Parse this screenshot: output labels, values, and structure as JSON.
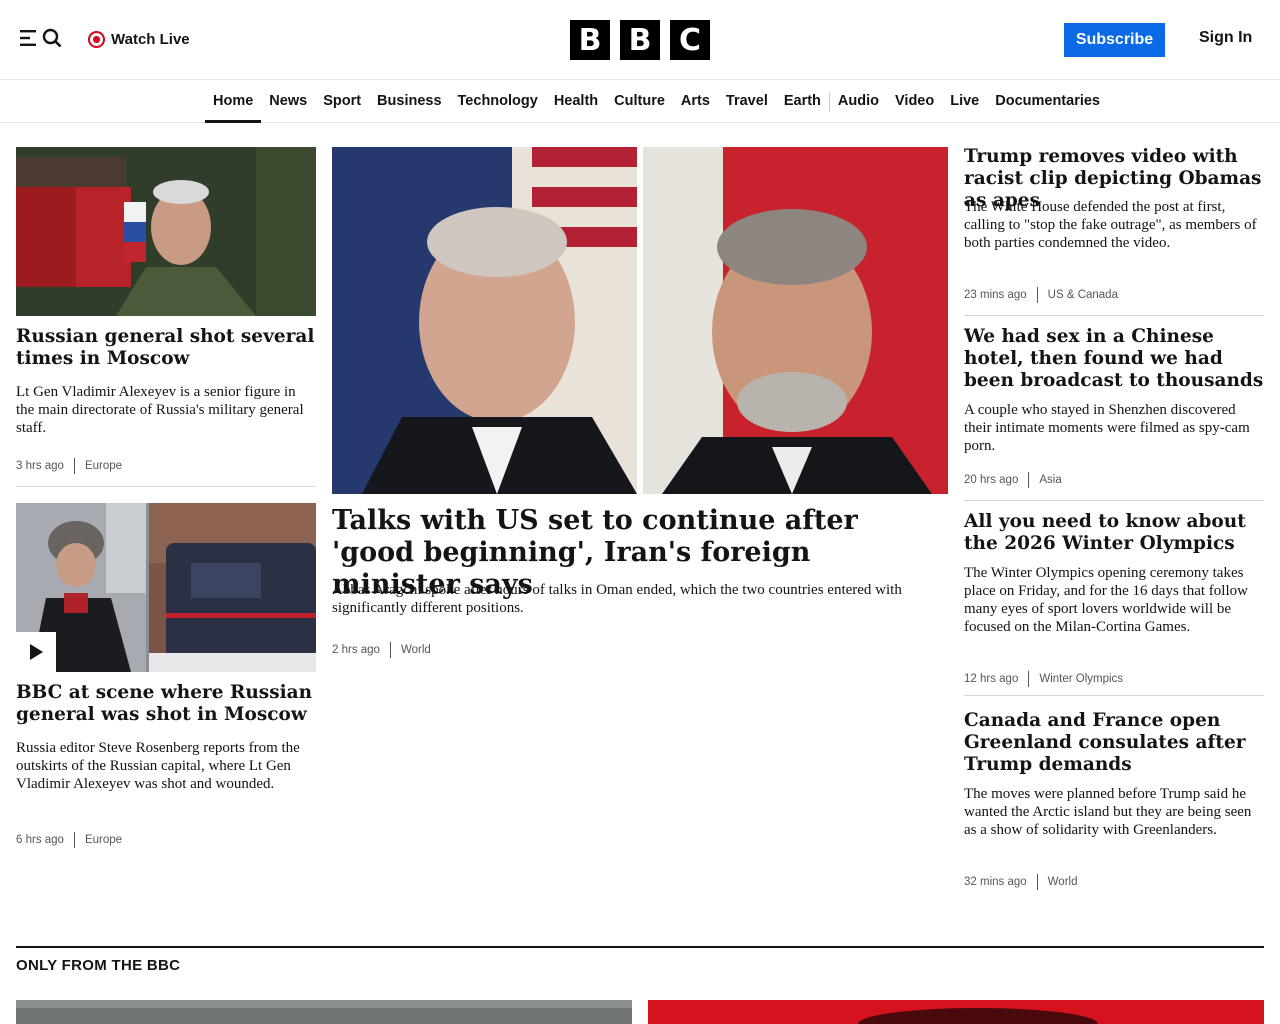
{
  "header": {
    "watch_live": "Watch Live",
    "logo_letters": [
      "B",
      "B",
      "C"
    ],
    "subscribe": "Subscribe",
    "sign_in": "Sign In"
  },
  "nav": {
    "items": [
      "Home",
      "News",
      "Sport",
      "Business",
      "Technology",
      "Health",
      "Culture",
      "Arts",
      "Travel",
      "Earth",
      "Audio",
      "Video",
      "Live",
      "Documentaries"
    ],
    "active": "Home"
  },
  "left": [
    {
      "headline": "Russian general shot several times in Moscow",
      "summary": "Lt Gen Vladimir Alexeyev is a senior figure in the main directorate of Russia's military general staff.",
      "time": "3 hrs ago",
      "section": "Europe"
    },
    {
      "headline": "BBC at scene where Russian general was shot in Moscow",
      "summary": "Russia editor Steve Rosenberg reports from the outskirts of the Russian capital, where Lt Gen Vladimir Alexeyev was shot and wounded.",
      "time": "6 hrs ago",
      "section": "Europe"
    }
  ],
  "main": {
    "headline": "Talks with US set to continue after 'good beginning', Iran's foreign minister says",
    "summary": "Abbas Aragchi spoke after hours of talks in Oman ended, which the two countries entered with significantly different positions.",
    "time": "2 hrs ago",
    "section": "World"
  },
  "right": [
    {
      "headline": "Trump removes video with racist clip depicting Obamas as apes",
      "summary": "The White House defended the post at first, calling to \"stop the fake outrage\", as members of both parties condemned the video.",
      "time": "23 mins ago",
      "section": "US & Canada"
    },
    {
      "headline": "We had sex in a Chinese hotel, then found we had been broadcast to thousands",
      "summary": "A couple who stayed in Shenzhen discovered their intimate moments were filmed as spy-cam porn.",
      "time": "20 hrs ago",
      "section": "Asia"
    },
    {
      "headline": "All you need to know about the 2026 Winter Olympics",
      "summary": "The Winter Olympics opening ceremony takes place on Friday, and for the 16 days that follow many eyes of sport lovers worldwide will be focused on the Milan-Cortina Games.",
      "time": "12 hrs ago",
      "section": "Winter Olympics"
    },
    {
      "headline": "Canada and France open Greenland consulates after Trump demands",
      "summary": "The moves were planned before Trump said he wanted the Arctic island but they are being seen as a show of solidarity with Greenlanders.",
      "time": "32 mins ago",
      "section": "World"
    }
  ],
  "section_title": "ONLY FROM THE BBC",
  "icons": {
    "menu": "menu-icon",
    "search": "search-icon",
    "live": "live-dot-icon",
    "play": "play-icon"
  },
  "colors": {
    "accent_blue": "#0a6ae5",
    "live_red": "#d6001c",
    "text": "#141414",
    "meta": "#545658"
  }
}
